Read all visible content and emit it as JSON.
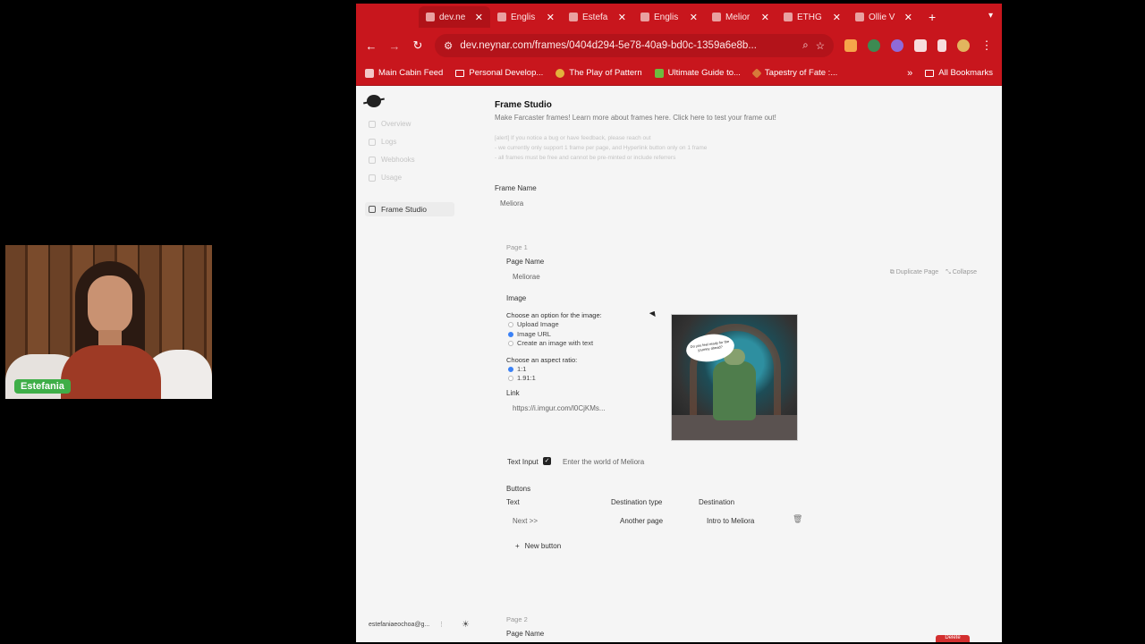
{
  "webcam": {
    "name": "Estefania"
  },
  "browser": {
    "tabs": [
      {
        "title": "dev.ne",
        "active": true
      },
      {
        "title": "Englis"
      },
      {
        "title": "Estefa"
      },
      {
        "title": "Englis"
      },
      {
        "title": "Melior"
      },
      {
        "title": "ETHG"
      },
      {
        "title": "Ollie V"
      }
    ],
    "new_tab": "+",
    "url": "dev.neynar.com/frames/0404d294-5e78-40a9-bd0c-1359a6e8b...",
    "bookmarks": [
      {
        "label": "Main Cabin Feed",
        "icon": "chrome-icon"
      },
      {
        "label": "Personal Develop...",
        "icon": "folder-icon"
      },
      {
        "label": "The Play of Pattern",
        "icon": "gold-circle-icon"
      },
      {
        "label": "Ultimate Guide to...",
        "icon": "green-square-icon"
      },
      {
        "label": "Tapestry of Fate :...",
        "icon": "diamond-icon"
      }
    ],
    "bookmarks_more": "»",
    "all_bookmarks": "All Bookmarks"
  },
  "sidebar": {
    "items": [
      {
        "label": "Overview"
      },
      {
        "label": "Logs"
      },
      {
        "label": "Webhooks"
      },
      {
        "label": "Usage"
      }
    ],
    "active_item": "Frame Studio",
    "user_email": "estefaniaeochoa@g..."
  },
  "studio": {
    "title": "Frame Studio",
    "description": "Make Farcaster frames! Learn more about frames here. Click here to test your frame out!",
    "notes": [
      "[alert] If you notice a bug or have feedback, please reach out",
      "- we currently only support 1 frame per page, and Hyperlink button only on 1 frame",
      "- all frames must be free and cannot be pre-minted or include referrers"
    ],
    "frame_name_label": "Frame Name",
    "frame_name_value": "Meliora"
  },
  "page1": {
    "section_label": "Page 1",
    "page_name_label": "Page Name",
    "page_name_value": "Meliorae",
    "duplicate_label": "Duplicate Page",
    "collapse_label": "Collapse",
    "image_label": "Image",
    "image_option_prompt": "Choose an option for the image:",
    "image_options": [
      "Upload Image",
      "Image URL",
      "Create an image with text"
    ],
    "image_selected": 1,
    "aspect_prompt": "Choose an aspect ratio:",
    "aspect_options": [
      "1:1",
      "1.91:1"
    ],
    "aspect_selected": 0,
    "link_label": "Link",
    "link_value": "https://i.imgur.com/l0CjKMs...",
    "preview_bubble_text": "Do you feel ready for the journey ahead?",
    "text_input_label": "Text Input",
    "text_input_checked": true,
    "text_input_placeholder": "Enter the world of Meliora",
    "buttons_label": "Buttons",
    "button_columns": [
      "Text",
      "Destination type",
      "Destination"
    ],
    "button_rows": [
      {
        "text": "Next >>",
        "type": "Another page",
        "destination": "Intro to Meliora"
      }
    ],
    "new_button_label": "New button"
  },
  "page2": {
    "section_label": "Page 2",
    "page_name_label": "Page Name",
    "delete_label": "Delete"
  }
}
